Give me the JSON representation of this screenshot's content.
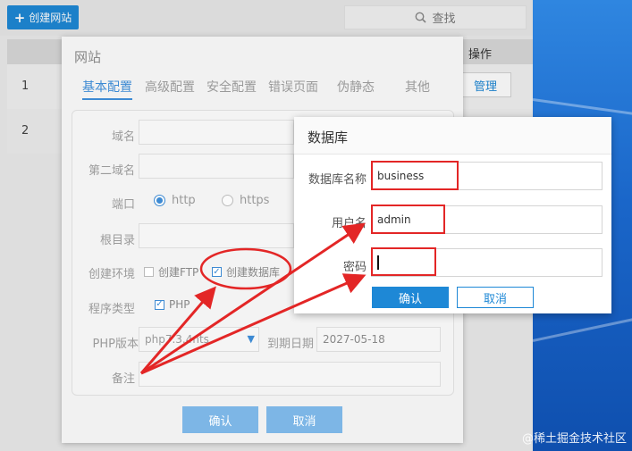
{
  "toolbar": {
    "create_site": "创建网站",
    "search_placeholder": "查找"
  },
  "table": {
    "ops_header": "操作",
    "rows": [
      "1",
      "2"
    ],
    "manage": "管理"
  },
  "site_dialog": {
    "title": "网站",
    "tabs": [
      "基本配置",
      "高级配置",
      "安全配置",
      "错误页面",
      "伪静态",
      "其他"
    ],
    "labels": {
      "domain": "域名",
      "second_domain": "第二域名",
      "port": "端口",
      "root": "根目录",
      "env": "创建环境",
      "prog": "程序类型",
      "php_version": "PHP版本",
      "expire": "到期日期",
      "note": "备注"
    },
    "port_options": [
      "http",
      "https"
    ],
    "env_options": [
      "创建FTP",
      "创建数据库"
    ],
    "prog_value": "PHP",
    "php_value": "php7.3.4nts",
    "expire_value": "2027-05-18",
    "confirm": "确认",
    "cancel": "取消"
  },
  "db_dialog": {
    "title": "数据库",
    "labels": {
      "name": "数据库名称",
      "user": "用户名",
      "password": "密码"
    },
    "values": {
      "name": "business",
      "user": "admin"
    },
    "confirm": "确认",
    "cancel": "取消"
  },
  "colors": {
    "accent": "#1e88d6",
    "annotation": "#e32626"
  },
  "watermark": "@稀土掘金技术社区"
}
